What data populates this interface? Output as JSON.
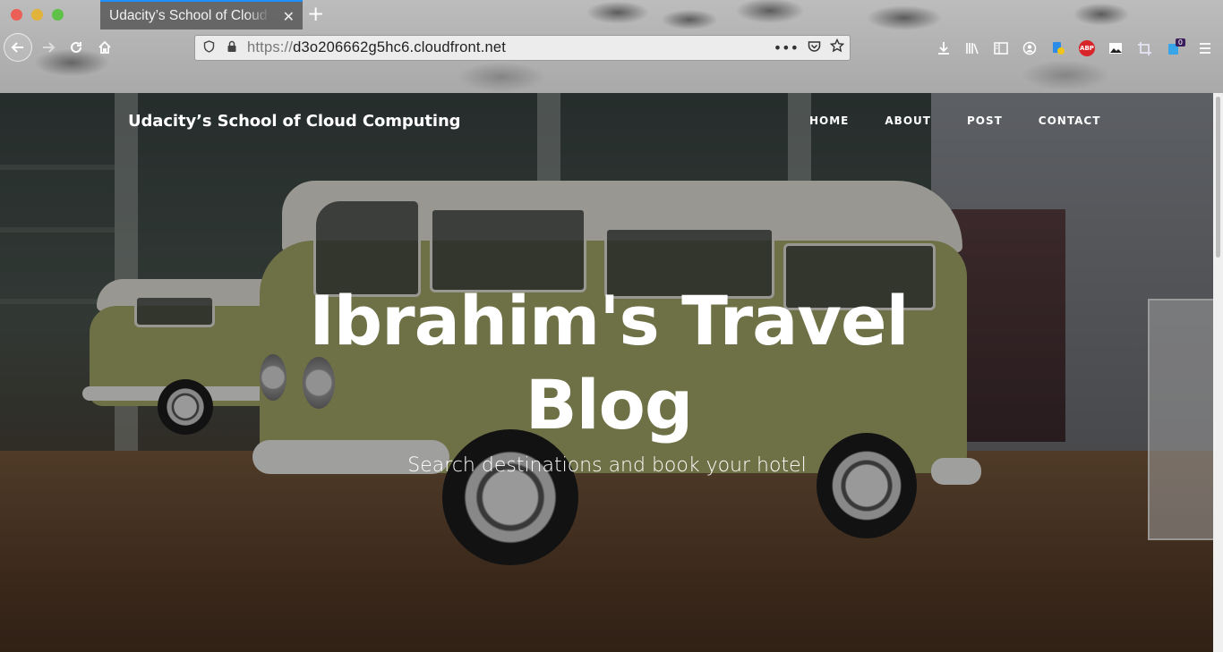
{
  "browser": {
    "tab_title": "Udacity’s School of Cloud Computing",
    "tab_close_glyph": "✕",
    "new_tab_glyph": "+",
    "url_protocol": "https://",
    "url_host": "d3o206662g5hc6.cloudfront.net",
    "url_actions_glyph": "•••",
    "extension_badge": "0",
    "abp_label": "ABP",
    "icons": [
      "back-arrow-icon",
      "forward-arrow-icon",
      "reload-icon",
      "home-icon",
      "shield-icon",
      "lock-icon",
      "pocket-icon",
      "bookmark-star-icon",
      "download-icon",
      "library-icon",
      "sidebar-icon",
      "account-icon",
      "extension-icon",
      "adblock-icon",
      "image-icon",
      "crop-icon",
      "menu-icon"
    ],
    "accent_color": "#1e8fff"
  },
  "site": {
    "brand": "Udacity’s School of Cloud Computing",
    "nav": [
      {
        "label": "HOME"
      },
      {
        "label": "ABOUT"
      },
      {
        "label": "POST"
      },
      {
        "label": "CONTACT"
      }
    ],
    "hero_title_line1": "Ibrahim's Travel",
    "hero_title_line2": "Blog",
    "hero_subtitle": "Search destinations and book your hotel"
  }
}
